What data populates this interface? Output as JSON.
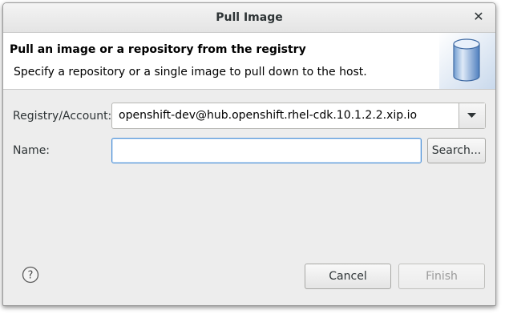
{
  "window": {
    "title": "Pull Image"
  },
  "banner": {
    "heading": "Pull an image or a repository from the registry",
    "description": "Specify a repository or a single image to pull down to the host."
  },
  "form": {
    "registry_label": "Registry/Account:",
    "registry_value": "openshift-dev@hub.openshift.rhel-cdk.10.1.2.2.xip.io",
    "name_label": "Name:",
    "name_value": "",
    "search_label": "Search..."
  },
  "footer": {
    "cancel_label": "Cancel",
    "finish_label": "Finish"
  },
  "icons": {
    "close": "close-icon",
    "dropdown": "chevron-down-icon",
    "help": "help-icon",
    "banner": "database-cylinder-icon"
  },
  "colors": {
    "focus_border": "#4a90d9",
    "dialog_bg": "#ededed"
  }
}
